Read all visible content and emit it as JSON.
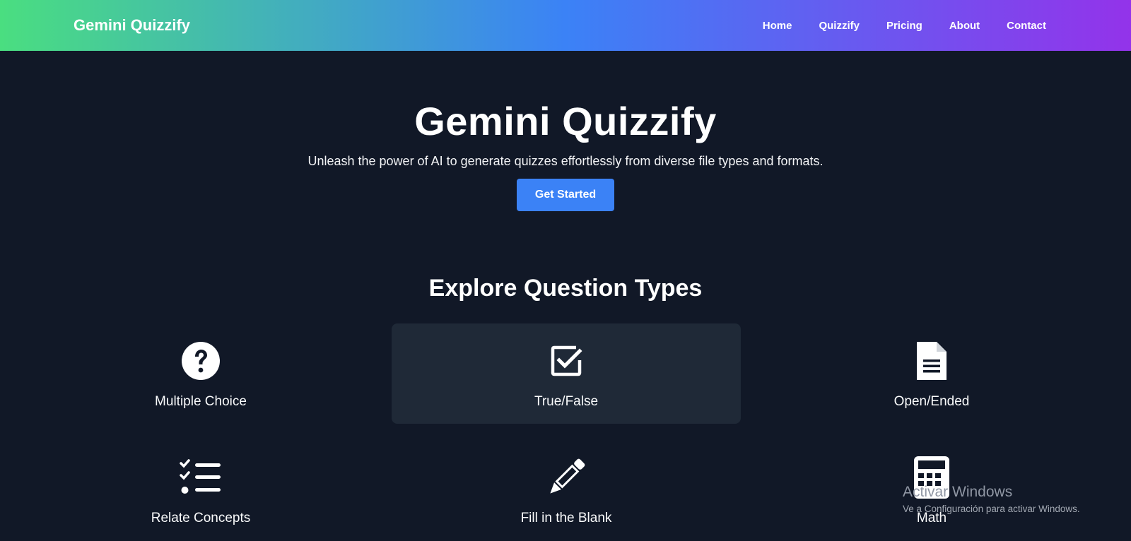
{
  "navbar": {
    "brand": "Gemini Quizzify",
    "links": [
      "Home",
      "Quizzify",
      "Pricing",
      "About",
      "Contact"
    ]
  },
  "hero": {
    "title": "Gemini Quizzify",
    "subtitle": "Unleash the power of AI to generate quizzes effortlessly from diverse file types and formats.",
    "cta_label": "Get Started"
  },
  "question_types": {
    "title": "Explore Question Types",
    "items": [
      {
        "label": "Multiple Choice",
        "icon": "question-circle-icon"
      },
      {
        "label": "True/False",
        "icon": "checkbox-icon",
        "highlighted": true
      },
      {
        "label": "Open/Ended",
        "icon": "document-icon"
      },
      {
        "label": "Relate Concepts",
        "icon": "checklist-icon"
      },
      {
        "label": "Fill in the Blank",
        "icon": "pencil-icon"
      },
      {
        "label": "Math",
        "icon": "calculator-icon"
      }
    ]
  },
  "watermark": {
    "title": "Activar Windows",
    "subtitle": "Ve a Configuración para activar Windows."
  },
  "colors": {
    "background": "#111827",
    "card_highlight": "#1f2937",
    "accent": "#3b82f6",
    "gradient_start": "#4ade80",
    "gradient_mid": "#3b82f6",
    "gradient_end": "#9333ea"
  }
}
